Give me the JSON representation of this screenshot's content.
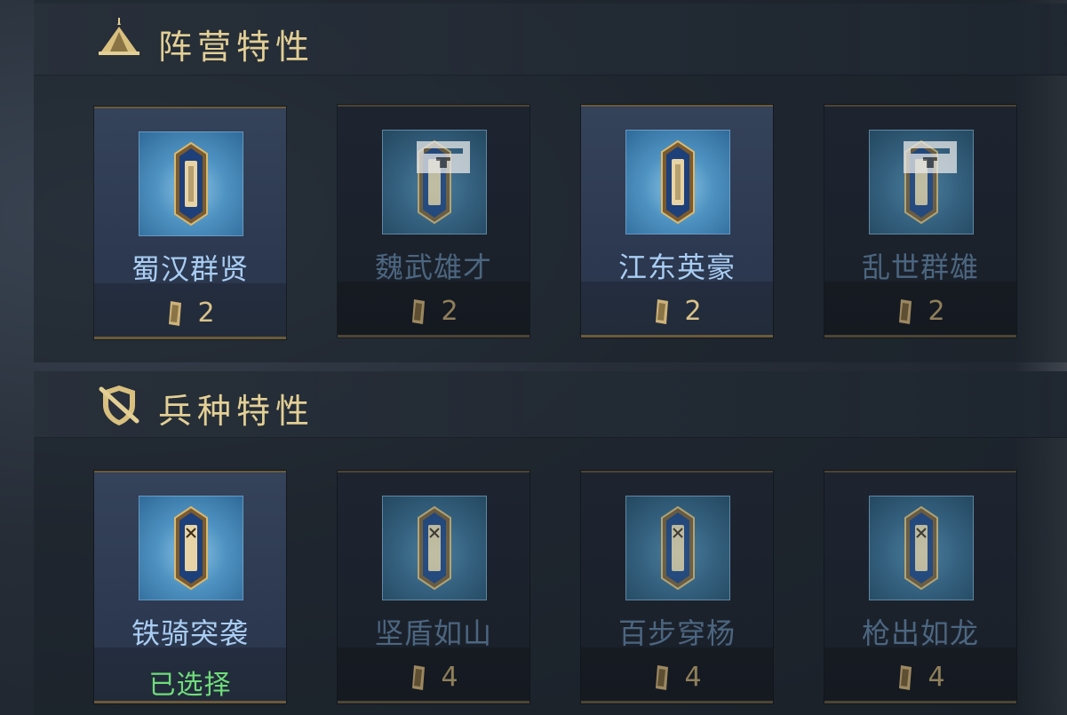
{
  "faction_section": {
    "title": "阵营特性",
    "icon": "tent-icon",
    "cards": [
      {
        "name": "蜀汉群贤",
        "cost": "2",
        "locked": false
      },
      {
        "name": "魏武雄才",
        "cost": "2",
        "locked": true
      },
      {
        "name": "江东英豪",
        "cost": "2",
        "locked": false
      },
      {
        "name": "乱世群雄",
        "cost": "2",
        "locked": true
      }
    ]
  },
  "troop_section": {
    "title": "兵种特性",
    "icon": "shield-sword-icon",
    "cards": [
      {
        "name": "铁骑突袭",
        "status": "已选择"
      },
      {
        "name": "坚盾如山",
        "cost": "4"
      },
      {
        "name": "百步穿杨",
        "cost": "4"
      },
      {
        "name": "枪出如龙",
        "cost": "4"
      }
    ]
  },
  "colors": {
    "title_gold": "#e3cf95",
    "name_blue": "#a9cdf2",
    "selected_green": "#6fdc7a"
  }
}
